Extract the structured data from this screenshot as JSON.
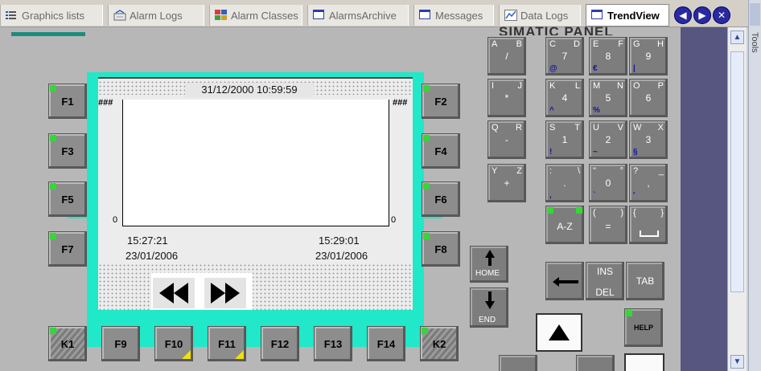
{
  "tabs": [
    {
      "label": "Graphics lists",
      "icon": "list-icon",
      "active": false
    },
    {
      "label": "Alarm Logs",
      "icon": "alarm-log-icon",
      "active": false
    },
    {
      "label": "Alarm Classes",
      "icon": "alarm-classes-icon",
      "active": false
    },
    {
      "label": "AlarmsArchive",
      "icon": "window-icon",
      "active": false
    },
    {
      "label": "Messages",
      "icon": "window-icon",
      "active": false
    },
    {
      "label": "Data Logs",
      "icon": "data-log-icon",
      "active": false
    },
    {
      "label": "TrendView",
      "icon": "window-icon",
      "active": true
    }
  ],
  "tab_nav": {
    "prev": "◀",
    "next": "▶",
    "close": "✕"
  },
  "sidebar": {
    "tools_label": "Tools"
  },
  "panel_title_partial": "SIMATIC PANEL",
  "function_keys": {
    "F1": "F1",
    "F2": "F2",
    "F3": "F3",
    "F4": "F4",
    "F5": "F5",
    "F6": "F6",
    "F7": "F7",
    "F8": "F8",
    "F9": "F9",
    "F10": "F10",
    "F11": "F11",
    "F12": "F12",
    "F13": "F13",
    "F14": "F14",
    "K1": "K1",
    "K2": "K2"
  },
  "trend": {
    "datetime": "31/12/2000 10:59:59",
    "overflow_left": "###",
    "overflow_right": "###",
    "y_zero_left": "0",
    "y_zero_right": "0",
    "x_start_time": "15:27:21",
    "x_start_date": "23/01/2006",
    "x_end_time": "15:29:01",
    "x_end_date": "23/01/2006"
  },
  "keypad": {
    "r1": [
      {
        "tl": "A",
        "tr": "B",
        "main": "/",
        "alt": ""
      },
      {
        "tl": "C",
        "tr": "D",
        "main": "7",
        "alt": "@"
      },
      {
        "tl": "E",
        "tr": "F",
        "main": "8",
        "alt": "€"
      },
      {
        "tl": "G",
        "tr": "H",
        "main": "9",
        "alt": "|"
      }
    ],
    "r2": [
      {
        "tl": "I",
        "tr": "J",
        "main": "*",
        "alt": ""
      },
      {
        "tl": "K",
        "tr": "L",
        "main": "4",
        "alt": "^"
      },
      {
        "tl": "M",
        "tr": "N",
        "main": "5",
        "alt": "%"
      },
      {
        "tl": "O",
        "tr": "P",
        "main": "6",
        "alt": ""
      }
    ],
    "r3": [
      {
        "tl": "Q",
        "tr": "R",
        "main": "-",
        "alt": ""
      },
      {
        "tl": "S",
        "tr": "T",
        "main": "1",
        "alt": "!"
      },
      {
        "tl": "U",
        "tr": "V",
        "main": "2",
        "alt": "~"
      },
      {
        "tl": "W",
        "tr": "X",
        "main": "3",
        "alt": "§"
      }
    ],
    "r4": [
      {
        "tl": "Y",
        "tr": "Z",
        "main": "+",
        "alt": ""
      },
      {
        "tl": ":",
        "tr": "\\",
        "main": ".",
        "alt": ","
      },
      {
        "tl": "\"",
        "tr": "°",
        "main": "0",
        "alt": "`"
      },
      {
        "tl": "?",
        "tr": "_",
        "main": ",",
        "alt": "'"
      }
    ],
    "az": "A-Z",
    "paren_open": "(",
    "paren_close": ")",
    "equals": "=",
    "brace_open": "{",
    "brace_close": "}",
    "home": "HOME",
    "end": "END",
    "ins": "INS",
    "del": "DEL",
    "tab": "TAB",
    "help": "HELP"
  },
  "colors": {
    "frame": "#20e8c8",
    "led": "#36d636",
    "indicator": "#f2e200",
    "tab_nav": "#2a2aa0",
    "side_strip": "#565680"
  }
}
